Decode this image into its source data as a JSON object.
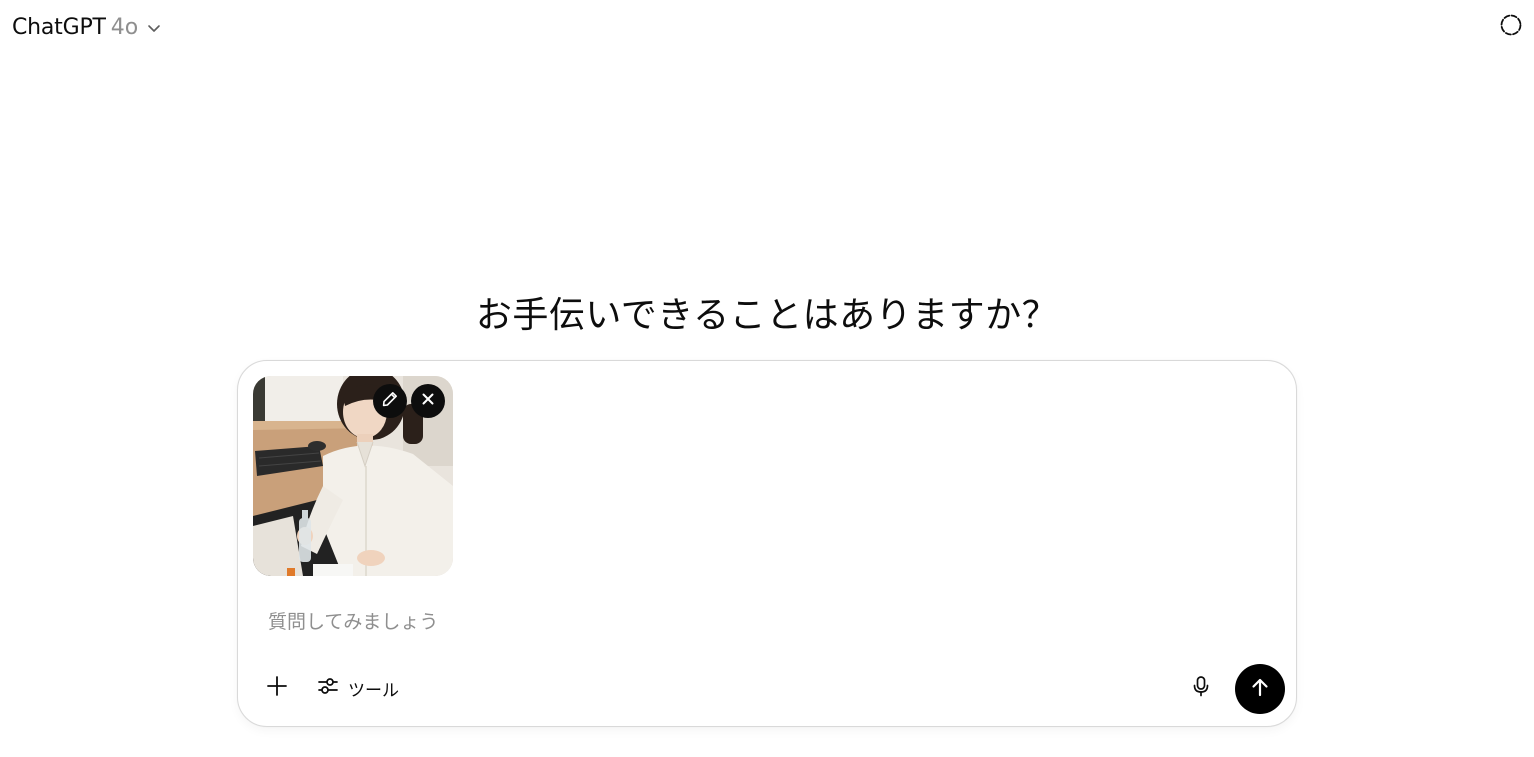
{
  "header": {
    "model_name": "ChatGPT",
    "model_version": "4o",
    "model_menu_icon": "chevron-down-icon",
    "temporary_chat_icon": "dashed-circle-icon"
  },
  "main": {
    "heading": "お手伝いできることはありますか？"
  },
  "composer": {
    "attachment": {
      "type": "image",
      "description_icon": "photo-thumbnail",
      "edit_icon": "pencil-icon",
      "remove_icon": "close-icon"
    },
    "input_placeholder": "質問してみましょう",
    "input_value": "",
    "add_icon": "plus-icon",
    "tools_label": "ツール",
    "tools_icon": "sliders-icon",
    "mic_icon": "microphone-icon",
    "send_icon": "arrow-up-icon"
  },
  "colors": {
    "text": "#0d0d0d",
    "muted": "#8f8f8f",
    "border": "#d9d9d9",
    "send_button": "#000000"
  }
}
